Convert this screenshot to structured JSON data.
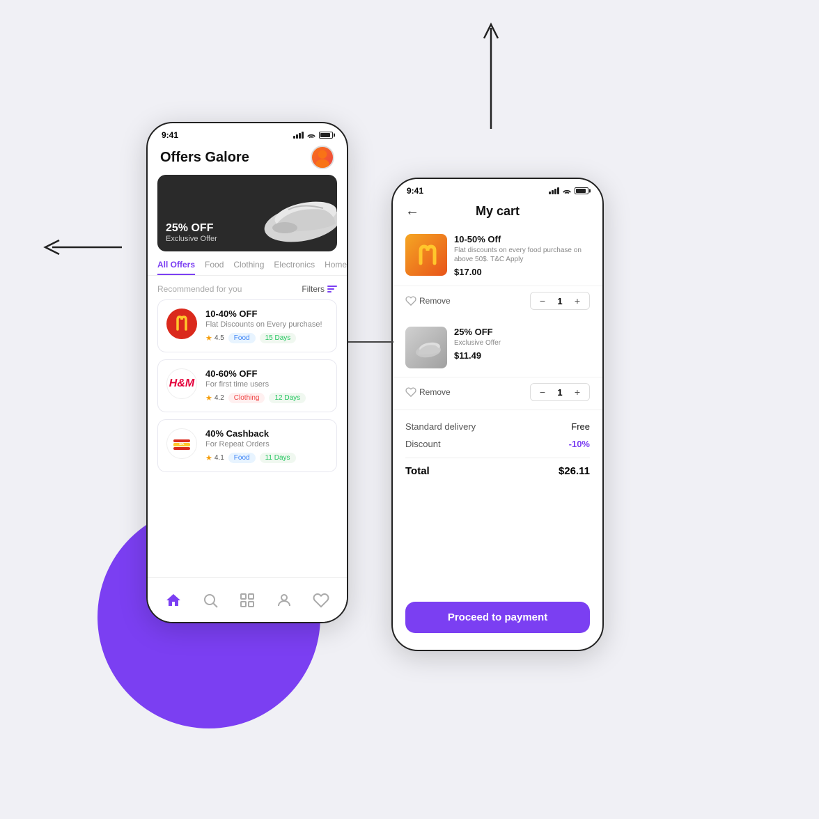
{
  "background_color": "#f0f0f5",
  "accent_color": "#7b3ff2",
  "left_phone": {
    "status_bar": {
      "time": "9:41"
    },
    "header": {
      "title": "Offers Galore"
    },
    "hero": {
      "discount": "25% OFF",
      "subtitle": "Exclusive Offer"
    },
    "tabs": [
      {
        "label": "All Offers",
        "active": true
      },
      {
        "label": "Food",
        "active": false
      },
      {
        "label": "Clothing",
        "active": false
      },
      {
        "label": "Electronics",
        "active": false
      },
      {
        "label": "Home",
        "active": false
      }
    ],
    "filter_section": {
      "label": "Recommended for you",
      "button": "Filters"
    },
    "offers": [
      {
        "title": "10-40% OFF",
        "desc": "Flat Discounts on Every purchase!",
        "brand": "mcdonalds",
        "rating": "4.5",
        "category": "Food",
        "days": "15 Days"
      },
      {
        "title": "40-60% OFF",
        "desc": "For first time users",
        "brand": "hm",
        "rating": "4.2",
        "category": "Clothing",
        "days": "12 Days"
      },
      {
        "title": "40% Cashback",
        "desc": "For Repeat Orders",
        "brand": "burgerking",
        "rating": "4.1",
        "category": "Food",
        "days": "11 Days"
      }
    ],
    "nav": {
      "items": [
        "home",
        "search",
        "grid",
        "user",
        "heart"
      ]
    }
  },
  "right_phone": {
    "status_bar": {
      "time": "9:41"
    },
    "header": {
      "back": "←",
      "title": "My cart"
    },
    "cart_items": [
      {
        "title": "10-50% Off",
        "desc": "Flat discounts on every food purchase on above 50$. T&C Apply",
        "price": "$17.00",
        "remove_label": "Remove",
        "qty": "1"
      },
      {
        "title": "25% OFF",
        "desc": "Exclusive Offer",
        "price": "$11.49",
        "remove_label": "Remove",
        "qty": "1"
      }
    ],
    "summary": {
      "delivery_label": "Standard delivery",
      "delivery_value": "Free",
      "discount_label": "Discount",
      "discount_value": "-10%",
      "total_label": "Total",
      "total_value": "$26.11"
    },
    "payment_button": "Proceed to payment"
  }
}
